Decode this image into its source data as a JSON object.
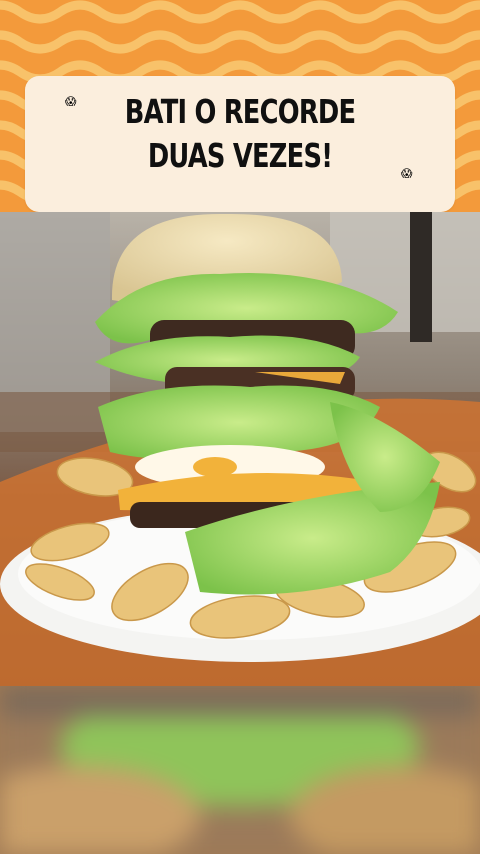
{
  "caption": {
    "line1": "BATI O RECORDE",
    "line2": "DUAS VEZES!",
    "emoji_left": "😱",
    "emoji_right": "😱"
  },
  "colors": {
    "background_orange": "#f39a3b",
    "pattern_wave": "#f8c26a",
    "caption_card": "#fbeedd",
    "caption_text": "#101010"
  },
  "photo": {
    "subject": "tall burger with lettuce, cheese and patties on plate of potato chips"
  }
}
